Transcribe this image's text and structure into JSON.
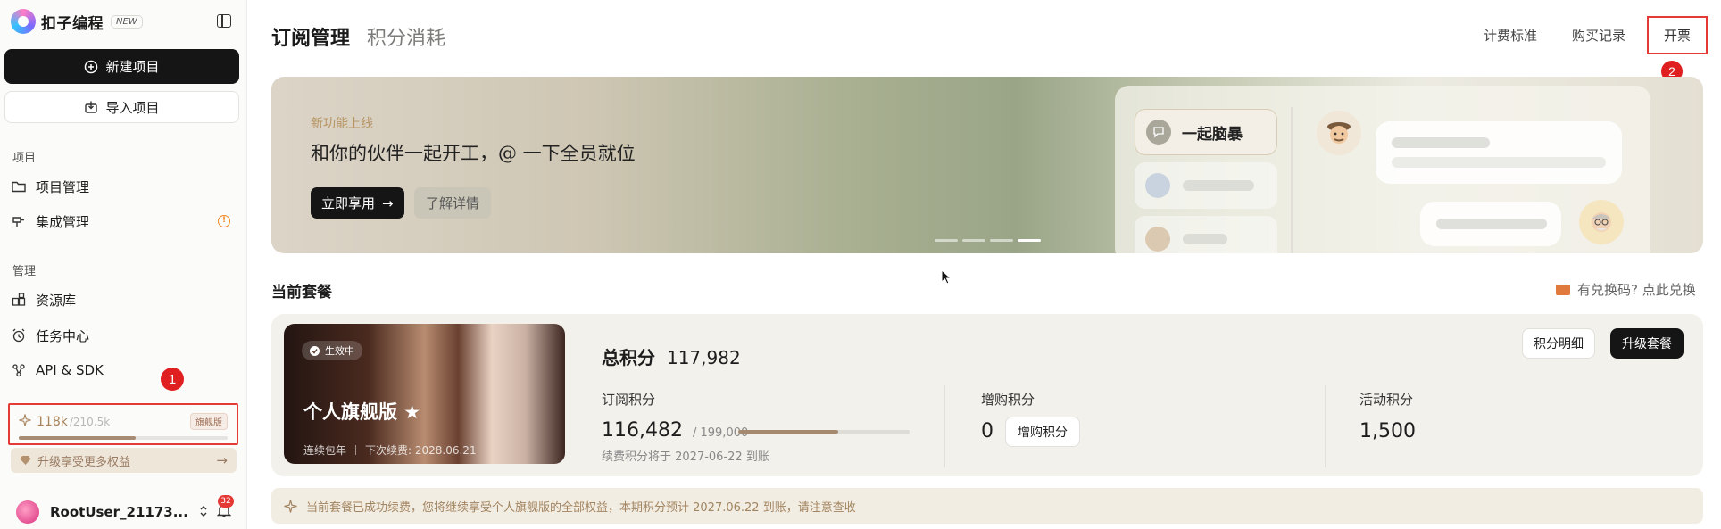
{
  "app": {
    "name": "扣子编程",
    "badge": "NEW"
  },
  "sidebar": {
    "new_project": "新建项目",
    "import_project": "导入项目",
    "section_project": "项目",
    "section_manage": "管理",
    "items": [
      {
        "label": "项目管理",
        "icon": "folder-icon"
      },
      {
        "label": "集成管理",
        "icon": "plug-icon"
      },
      {
        "label": "资源库",
        "icon": "library-icon"
      },
      {
        "label": "任务中心",
        "icon": "alarm-clock-icon"
      },
      {
        "label": "API & SDK",
        "icon": "api-nodes-icon"
      }
    ],
    "credits": {
      "used": "118k",
      "total": "/210.5k",
      "tier": "旗舰版",
      "progress": 0.56
    },
    "upgrade": "升级享受更多权益",
    "user": {
      "name": "RootUser_21173...",
      "notifications": "32"
    },
    "markers": {
      "credits": "1"
    }
  },
  "header": {
    "tabs": [
      {
        "label": "订阅管理",
        "active": true
      },
      {
        "label": "积分消耗",
        "active": false
      }
    ],
    "links": {
      "pricing": "计费标准",
      "purchase_history": "购买记录",
      "invoice": "开票"
    },
    "markers": {
      "invoice": "2"
    }
  },
  "banner": {
    "subtitle": "新功能上线",
    "title": "和你的伙伴一起开工，@ 一下全员就位",
    "try_button": "立即享用",
    "more_button": "了解详情",
    "feature_chip": "一起脑暴",
    "slides": 4,
    "active_slide": 4
  },
  "plan": {
    "section_title": "当前套餐",
    "redeem": "有兑换码? 点此兑换",
    "status": "生效中",
    "name": "个人旗舰版 ★",
    "billing": "连续包年",
    "renewal": "下次续费: 2028.06.21",
    "total_label": "总积分",
    "total_value": "117,982",
    "detail_button": "积分明细",
    "upgrade_button": "升级套餐",
    "subscription": {
      "label": "订阅积分",
      "value": "116,482",
      "total": "/ 199,000",
      "progress": 0.585,
      "note": "续费积分将于 2027-06-22 到账"
    },
    "purchased": {
      "label": "增购积分",
      "value": "0",
      "button": "增购积分"
    },
    "activity": {
      "label": "活动积分",
      "value": "1,500"
    }
  },
  "notice": "当前套餐已成功续费，您将继续享受个人旗舰版的全部权益，本期积分预计 2027.06.22 到账，请注意查收",
  "colors": {
    "accent_dark": "#151515",
    "highlight": "#e53935",
    "gold": "#a8835b"
  }
}
